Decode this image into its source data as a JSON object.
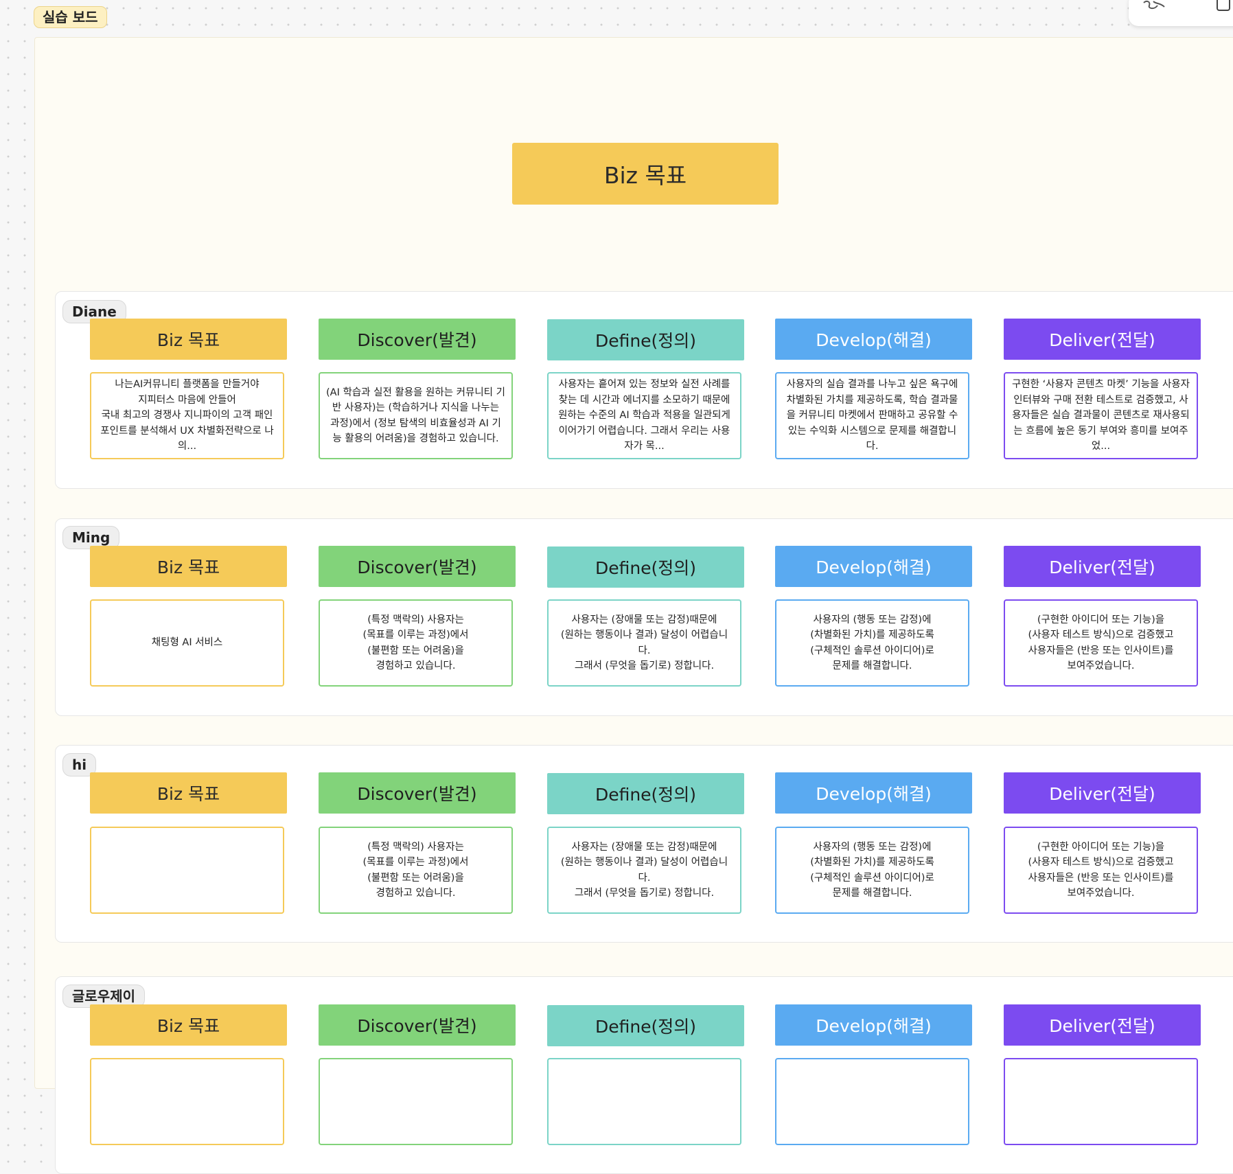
{
  "board": {
    "label": "실습 보드",
    "hero_title": "Biz 목표"
  },
  "columns": {
    "biz": "Biz 목표",
    "discover": "Discover(발견)",
    "define": "Define(정의)",
    "develop": "Develop(해결)",
    "deliver": "Deliver(전달)"
  },
  "sections": [
    {
      "name": "Diane",
      "cards": {
        "biz": "나는AI커뮤니티 플랫폼을 만들거야\n지피터스 마음에 안들어\n국내 최고의 경쟁사 지니파이의 고객 패인포인트를 분석해서 UX 차별화전략으로 나의...",
        "discover": "(AI 학습과 실전 활용을 원하는 커뮤니티 기반 사용자)는 (학습하거나 지식을 나누는 과정)에서 (정보 탐색의 비효율성과 AI 기능 활용의 어려움)을 경험하고 있습니다.",
        "define": "사용자는 흩어져 있는 정보와 실전 사례를 찾는 데 시간과 에너지를 소모하기 때문에 원하는 수준의 AI 학습과 적용을 일관되게 이어가기 어렵습니다. 그래서 우리는 사용자가 목...",
        "develop": "사용자의 실습 결과를 나누고 싶은 욕구에 차별화된 가치를 제공하도록, 학습 결과물을 커뮤니티 마켓에서 판매하고 공유할 수 있는 수익화 시스템으로 문제를 해결합니다.",
        "deliver": "구현한 ‘사용자 콘텐츠 마켓’ 기능을 사용자 인터뷰와 구매 전환 테스트로 검증했고, 사용자들은 실습 결과물이 콘텐츠로 재사용되는 흐름에 높은 동기 부여와 흥미를 보여주었..."
      }
    },
    {
      "name": "Ming",
      "cards": {
        "biz": "채팅형 AI 서비스",
        "discover": "(특정 맥락의) 사용자는\n(목표를 이루는 과정)에서\n(불편함 또는 어려움)을\n경험하고 있습니다.",
        "define": "사용자는 (장애물 또는 감정)때문에\n(원하는 행동이나 결과) 달성이 어렵습니다.\n그래서 (무엇을 돕기로) 정합니다.",
        "develop": "사용자의 (행동 또는 감정)에\n(차별화된 가치)를 제공하도록\n(구체적인 솔루션 아이디어)로\n문제를 해결합니다.",
        "deliver": "(구현한 아이디어 또는 기능)을\n(사용자 테스트 방식)으로 검증했고\n사용자들은 (반응 또는 인사이트)를\n보여주었습니다."
      }
    },
    {
      "name": "hi",
      "cards": {
        "biz": "",
        "discover": "(특정 맥락의) 사용자는\n(목표를 이루는 과정)에서\n(불편함 또는 어려움)을\n경험하고 있습니다.",
        "define": "사용자는 (장애물 또는 감정)때문에\n(원하는 행동이나 결과) 달성이 어렵습니다.\n그래서 (무엇을 돕기로) 정합니다.",
        "develop": "사용자의 (행동 또는 감정)에\n(차별화된 가치)를 제공하도록\n(구체적인 솔루션 아이디어)로\n문제를 해결합니다.",
        "deliver": "(구현한 아이디어 또는 기능)을\n(사용자 테스트 방식)으로 검증했고\n사용자들은 (반응 또는 인사이트)를\n보여주었습니다."
      }
    },
    {
      "name": "글로우제이",
      "cards": {
        "biz": "",
        "discover": "",
        "define": "",
        "develop": "",
        "deliver": ""
      }
    }
  ],
  "colors": {
    "biz": "#f5ca58",
    "discover": "#82d37a",
    "define": "#7bd4c7",
    "develop": "#5aaaf1",
    "deliver": "#7c4bf0"
  },
  "icons": {
    "top_widget": [
      "scribble-avatar-icon",
      "window-icon"
    ]
  }
}
